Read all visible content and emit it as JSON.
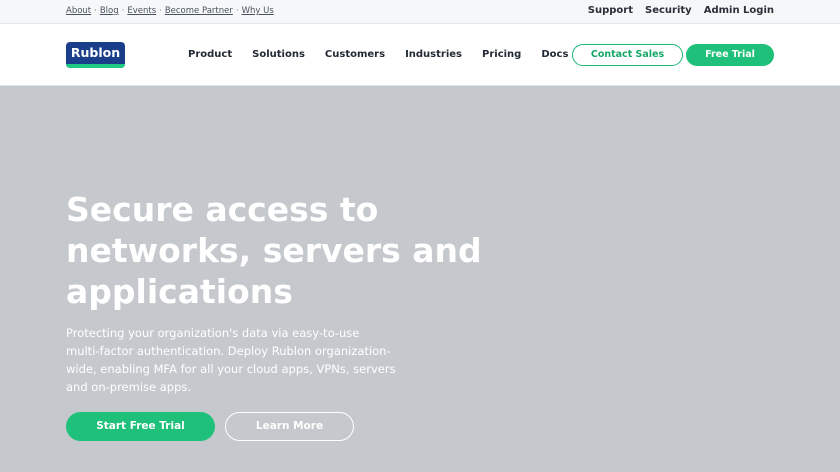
{
  "topbar": {
    "links": [
      "About",
      "Blog",
      "Events",
      "Become Partner",
      "Why Us"
    ],
    "separator": "·",
    "right_links": [
      "Support",
      "Security",
      "Admin Login"
    ]
  },
  "brand": {
    "logo_text": "Rublon",
    "logo_color": "#1a3e8a",
    "accent_color": "#1fc07a"
  },
  "nav": {
    "items": [
      "Product",
      "Solutions",
      "Customers",
      "Industries",
      "Pricing",
      "Docs"
    ],
    "contact_label": "Contact Sales",
    "trial_label": "Free Trial"
  },
  "hero": {
    "title": "Secure access to networks, servers and applications",
    "text": "Protecting your organization's data via easy-to-use multi-factor authentication. Deploy Rublon organization-wide, enabling MFA for all your cloud apps, VPNs, servers and on-premise apps.",
    "start_label": "Start Free Trial",
    "learn_label": "Learn More"
  }
}
